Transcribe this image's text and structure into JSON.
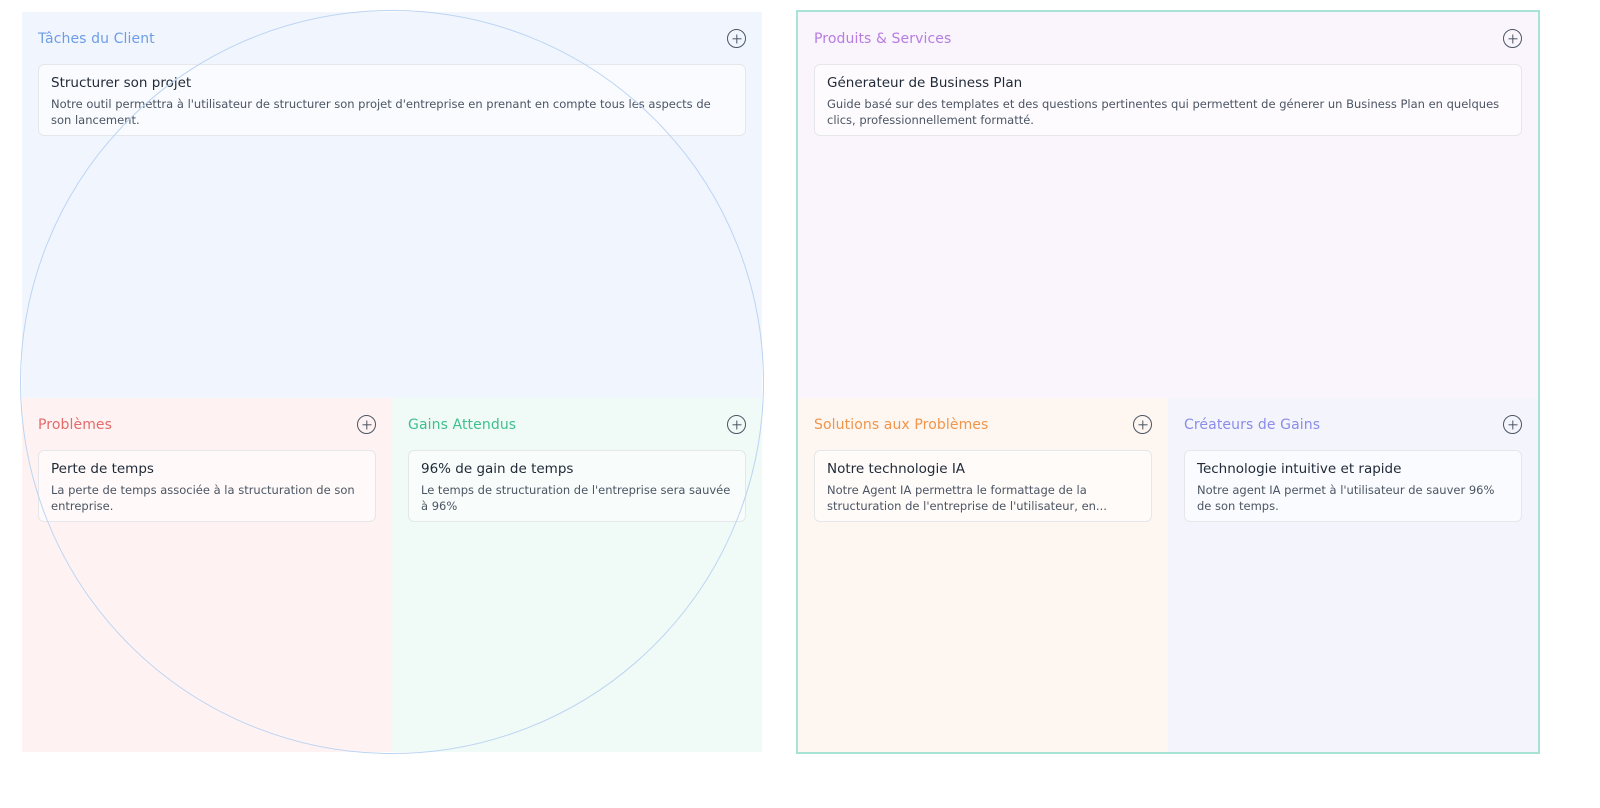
{
  "profile": {
    "customer_jobs": {
      "title": "Tâches du Client",
      "title_color": "#6d9de6",
      "background": "#f1f6fe",
      "card": {
        "title": "Structurer son projet",
        "description": "Notre outil permettra à l'utilisateur de structurer son projet d'entreprise en prenant en compte tous les aspects de son lancement."
      }
    },
    "pains": {
      "title": "Problèmes",
      "title_color": "#e36b6b",
      "background": "#fef3f2",
      "card": {
        "title": "Perte de temps",
        "description": "La perte de temps associée à la structuration de son entreprise."
      }
    },
    "gains": {
      "title": "Gains Attendus",
      "title_color": "#3fbf8f",
      "background": "#f0faf6",
      "card": {
        "title": "96% de gain de temps",
        "description": "Le temps de structuration de l'entreprise sera sauvée à 96%"
      }
    }
  },
  "value_map": {
    "products_services": {
      "title": "Produits & Services",
      "title_color": "#b77ce0",
      "background": "#faf5fd",
      "card": {
        "title": "Génerateur de Business Plan",
        "description": "Guide basé sur des templates et des questions pertinentes qui permettent de génerer un Business Plan en quelques clics, professionnellement formatté."
      }
    },
    "pain_relievers": {
      "title": "Solutions aux Problèmes",
      "title_color": "#f0954a",
      "background": "#fef6f1",
      "card": {
        "title": "Notre technologie IA",
        "description": "Notre Agent IA permettra le formattage de la structuration de l'entreprise de l'utilisateur, en..."
      }
    },
    "gain_creators": {
      "title": "Créateurs de Gains",
      "title_color": "#8a8ce8",
      "background": "#f4f5fc",
      "card": {
        "title": "Technologie intuitive et rapide",
        "description": "Notre agent IA permet à l'utilisateur de sauver 96% de son temps."
      }
    },
    "border_color": "#a8e4d6"
  },
  "circle_color": "#bcd4f3"
}
